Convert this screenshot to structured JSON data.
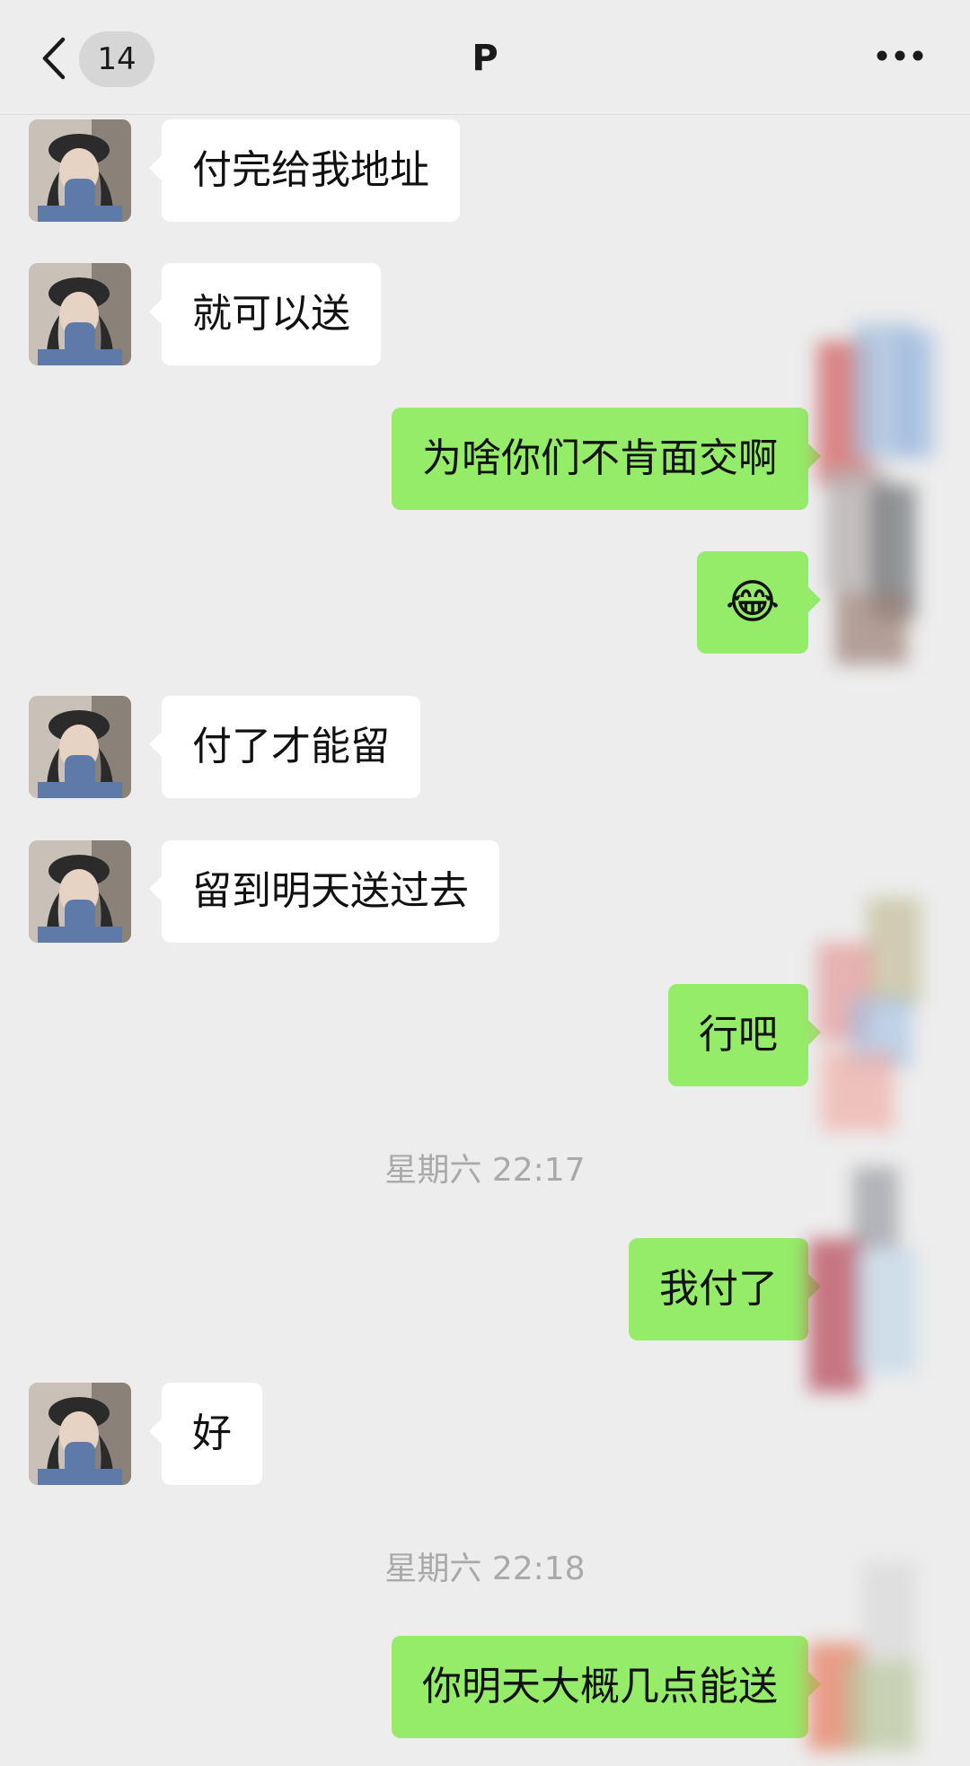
{
  "header": {
    "unread_count": "14",
    "title": "P"
  },
  "messages": [
    {
      "side": "in",
      "text": "付完给我地址"
    },
    {
      "side": "in",
      "text": "就可以送"
    },
    {
      "side": "out",
      "text": "为啥你们不肯面交啊"
    },
    {
      "side": "out",
      "text": "😂",
      "type": "emoji"
    },
    {
      "side": "in",
      "text": "付了才能留"
    },
    {
      "side": "in",
      "text": "留到明天送过去"
    },
    {
      "side": "out",
      "text": "行吧"
    },
    {
      "type": "timestamp",
      "text": "星期六 22:17"
    },
    {
      "side": "out",
      "text": "我付了"
    },
    {
      "side": "in",
      "text": "好"
    },
    {
      "type": "timestamp",
      "text": "星期六 22:18"
    },
    {
      "side": "out",
      "text": "你明天大概几点能送"
    }
  ],
  "colors": {
    "background": "#ededed",
    "incoming_bubble": "#ffffff",
    "outgoing_bubble": "#95ec69",
    "timestamp": "#a9a9a9"
  },
  "icons": {
    "back": "chevron-left-icon",
    "more": "more-dots-icon",
    "avatar": "contact-avatar"
  }
}
